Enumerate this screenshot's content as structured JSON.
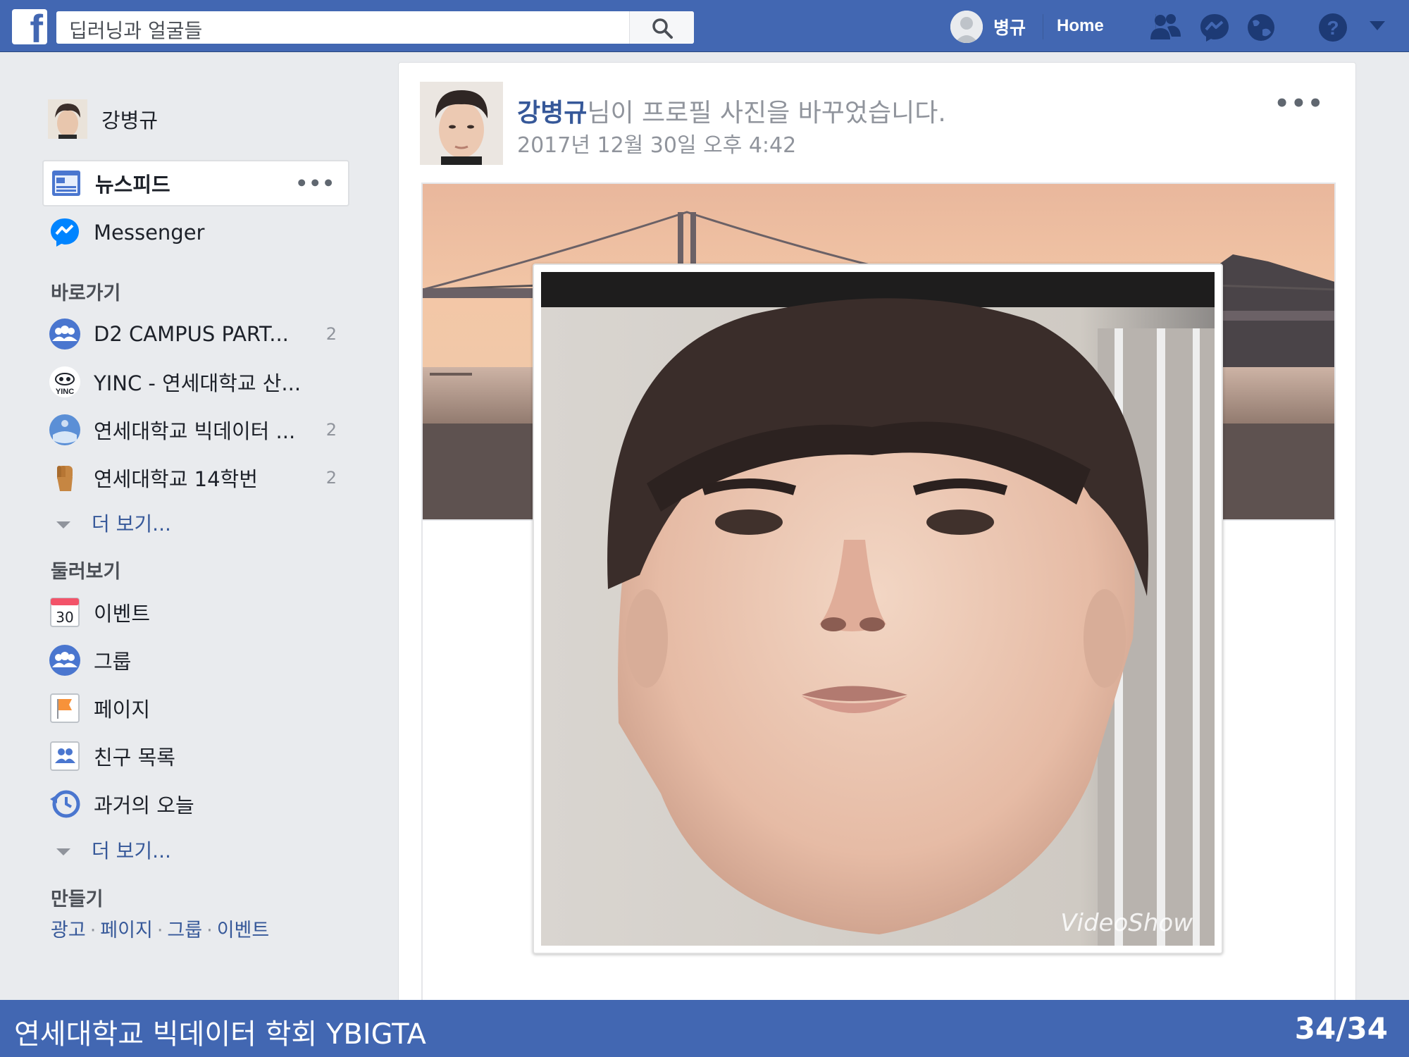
{
  "topbar": {
    "search_value": "딥러닝과 얼굴들",
    "user_name": "병규",
    "home_label": "Home"
  },
  "sidebar": {
    "profile_name": "강병규",
    "items_main": [
      {
        "label": "뉴스피드",
        "icon": "news-feed-icon"
      },
      {
        "label": "Messenger",
        "icon": "messenger-icon"
      }
    ],
    "shortcuts_title": "바로가기",
    "shortcuts": [
      {
        "label": "D2 CAMPUS PART...",
        "count": "2",
        "icon": "group-icon"
      },
      {
        "label": "YINC - 연세대학교 산...",
        "count": "",
        "icon": "yinc-logo-icon"
      },
      {
        "label": "연세대학교 빅데이터 ...",
        "count": "2",
        "icon": "ybigta-logo-icon"
      },
      {
        "label": "연세대학교 14학번",
        "count": "2",
        "icon": "fist-icon"
      }
    ],
    "see_more": "더 보기...",
    "explore_title": "둘러보기",
    "explore": [
      {
        "label": "이벤트",
        "icon": "calendar-icon",
        "calendar_day": "30"
      },
      {
        "label": "그룹",
        "icon": "group-icon"
      },
      {
        "label": "페이지",
        "icon": "flag-icon"
      },
      {
        "label": "친구 목록",
        "icon": "friends-list-icon"
      },
      {
        "label": "과거의 오늘",
        "icon": "memories-clock-icon"
      }
    ],
    "see_more_2": "더 보기...",
    "create_title": "만들기",
    "create_links": [
      "광고",
      "페이지",
      "그룹",
      "이벤트"
    ]
  },
  "post": {
    "author": "강병규",
    "action_text": "님이 프로필 사진을 바꾸었습니다.",
    "timestamp": "2017년 12월 30일 오후 4:42",
    "more_label": "•••",
    "watermark": "VideoShow"
  },
  "footer": {
    "left_text": "연세대학교 빅데이터 학회 YBIGTA",
    "page_counter": "34/34"
  },
  "colors": {
    "brand_blue": "#4267b2",
    "link_blue": "#365899",
    "background": "#e9ebee"
  }
}
